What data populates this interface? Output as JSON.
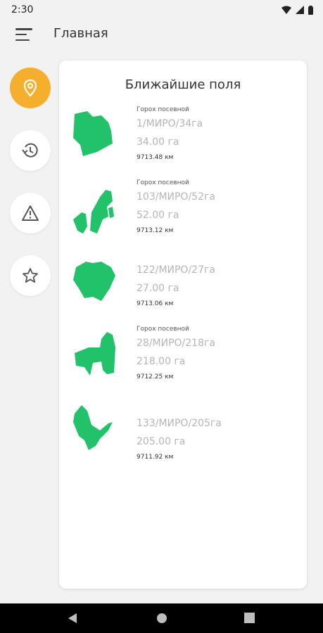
{
  "status": {
    "time": "2:30"
  },
  "appbar": {
    "title": "Главная",
    "menu_icon": "menu-icon"
  },
  "rail": {
    "items": [
      {
        "name": "location-pin-icon",
        "active": true
      },
      {
        "name": "history-icon",
        "active": false
      },
      {
        "name": "warning-icon",
        "active": false
      },
      {
        "name": "star-icon",
        "active": false
      }
    ]
  },
  "card": {
    "title": "Ближайшие поля",
    "fields": [
      {
        "crop": "Горох посевной",
        "name": "1/МИРО/34га",
        "area": "34.00 га",
        "distance": "9713.48 км"
      },
      {
        "crop": "Горох посевной",
        "name": "103/МИРО/52га",
        "area": "52.00 га",
        "distance": "9713.12 км"
      },
      {
        "crop": "",
        "name": "122/МИРО/27га",
        "area": "27.00 га",
        "distance": "9713.06 км"
      },
      {
        "crop": "Горох посевной",
        "name": "28/МИРО/218га",
        "area": "218.00 га",
        "distance": "9712.25 км"
      },
      {
        "crop": "",
        "name": "133/МИРО/205га",
        "area": "205.00 га",
        "distance": "9711.92 км"
      }
    ]
  },
  "colors": {
    "accent": "#f6ae2d",
    "field_fill": "#22c26a",
    "background": "#f2f2f2"
  }
}
